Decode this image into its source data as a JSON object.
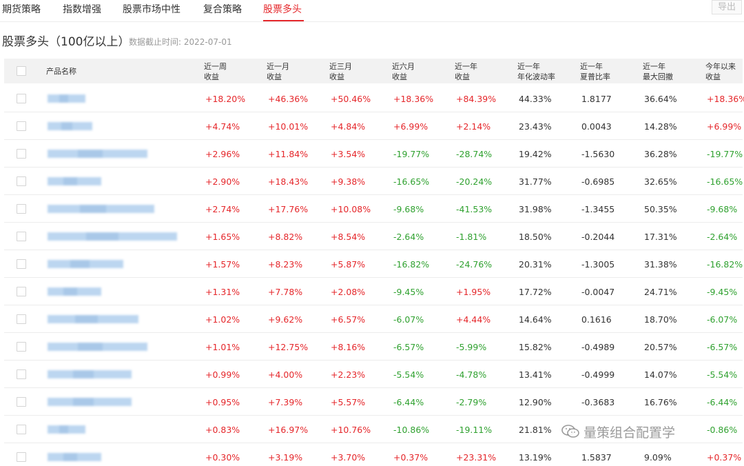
{
  "tabs": [
    {
      "label": "期货策略",
      "active": false
    },
    {
      "label": "指数增强",
      "active": false
    },
    {
      "label": "股票市场中性",
      "active": false
    },
    {
      "label": "复合策略",
      "active": false
    },
    {
      "label": "股票多头",
      "active": true
    }
  ],
  "export_label": "导出",
  "section": {
    "title": "股票多头（100亿以上）",
    "cutoff": "数据截止时间: 2022-07-01"
  },
  "columns": [
    {
      "line1": "产品名称",
      "line2": ""
    },
    {
      "line1": "近一周",
      "line2": "收益"
    },
    {
      "line1": "近一月",
      "line2": "收益"
    },
    {
      "line1": "近三月",
      "line2": "收益"
    },
    {
      "line1": "近六月",
      "line2": "收益"
    },
    {
      "line1": "近一年",
      "line2": "收益"
    },
    {
      "line1": "近一年",
      "line2": "年化波动率"
    },
    {
      "line1": "近一年",
      "line2": "夏普比率"
    },
    {
      "line1": "近一年",
      "line2": "最大回撤"
    },
    {
      "line1": "今年以来",
      "line2": "收益"
    }
  ],
  "rows": [
    [
      "+18.20%",
      "+46.36%",
      "+50.46%",
      "+18.36%",
      "+84.39%",
      "44.33%",
      "1.8177",
      "36.64%",
      "+18.36%"
    ],
    [
      "+4.74%",
      "+10.01%",
      "+4.84%",
      "+6.99%",
      "+2.14%",
      "23.43%",
      "0.0043",
      "14.28%",
      "+6.99%"
    ],
    [
      "+2.96%",
      "+11.84%",
      "+3.54%",
      "-19.77%",
      "-28.74%",
      "19.42%",
      "-1.5630",
      "36.28%",
      "-19.77%"
    ],
    [
      "+2.90%",
      "+18.43%",
      "+9.38%",
      "-16.65%",
      "-20.24%",
      "31.77%",
      "-0.6985",
      "32.65%",
      "-16.65%"
    ],
    [
      "+2.74%",
      "+17.76%",
      "+10.08%",
      "-9.68%",
      "-41.53%",
      "31.98%",
      "-1.3455",
      "50.35%",
      "-9.68%"
    ],
    [
      "+1.65%",
      "+8.82%",
      "+8.54%",
      "-2.64%",
      "-1.81%",
      "18.50%",
      "-0.2044",
      "17.31%",
      "-2.64%"
    ],
    [
      "+1.57%",
      "+8.23%",
      "+5.87%",
      "-16.82%",
      "-24.76%",
      "20.31%",
      "-1.3005",
      "31.38%",
      "-16.82%"
    ],
    [
      "+1.31%",
      "+7.78%",
      "+2.08%",
      "-9.45%",
      "+1.95%",
      "17.72%",
      "-0.0047",
      "24.71%",
      "-9.45%"
    ],
    [
      "+1.02%",
      "+9.62%",
      "+6.57%",
      "-6.07%",
      "+4.44%",
      "14.64%",
      "0.1616",
      "18.70%",
      "-6.07%"
    ],
    [
      "+1.01%",
      "+12.75%",
      "+8.16%",
      "-6.57%",
      "-5.99%",
      "15.82%",
      "-0.4989",
      "20.57%",
      "-6.57%"
    ],
    [
      "+0.99%",
      "+4.00%",
      "+2.23%",
      "-5.54%",
      "-4.78%",
      "13.41%",
      "-0.4999",
      "14.07%",
      "-5.54%"
    ],
    [
      "+0.95%",
      "+7.39%",
      "+5.57%",
      "-6.44%",
      "-2.79%",
      "12.90%",
      "-0.3683",
      "16.76%",
      "-6.44%"
    ],
    [
      "+0.83%",
      "+16.97%",
      "+10.76%",
      "-10.86%",
      "-19.11%",
      "21.81%",
      "",
      "",
      "-0.86%"
    ],
    [
      "+0.30%",
      "+3.19%",
      "+3.70%",
      "+0.37%",
      "+23.31%",
      "13.19%",
      "1.5837",
      "9.09%",
      "+0.37%"
    ]
  ],
  "watermark": "量策组合配置学",
  "colors": {
    "up": "#e5262a",
    "down": "#2fa12f",
    "accent": "#e5262a"
  }
}
